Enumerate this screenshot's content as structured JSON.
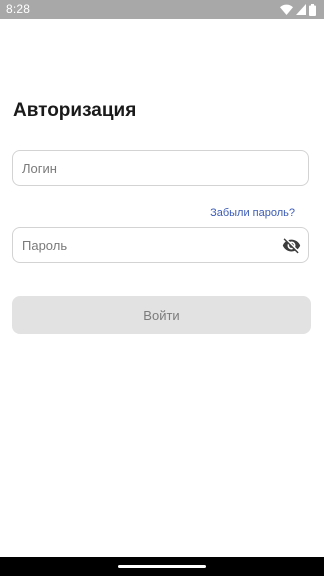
{
  "status_bar": {
    "time": "8:28",
    "icons": [
      "wifi-icon",
      "signal-icon",
      "battery-icon"
    ]
  },
  "screen": {
    "title": "Авторизация"
  },
  "login": {
    "placeholder": "Логин",
    "value": ""
  },
  "forgot_password": {
    "label": "Забыли пароль?"
  },
  "password": {
    "placeholder": "Пароль",
    "value": "",
    "toggle_icon": "visibility-off-icon"
  },
  "submit": {
    "label": "Войти",
    "enabled": false
  },
  "colors": {
    "status_bar": "#a8a8a8",
    "link": "#3b5bb5",
    "button_disabled_bg": "#e2e2e2",
    "button_disabled_text": "#7c7c7c",
    "field_border": "#d3d3d3"
  }
}
